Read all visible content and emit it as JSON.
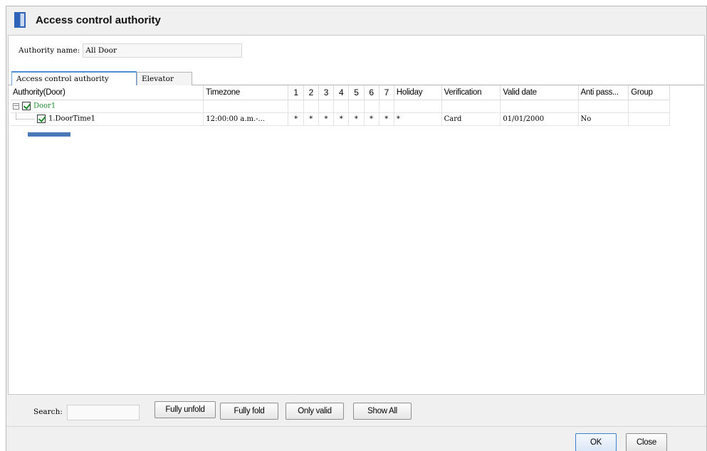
{
  "window": {
    "title": "Access control authority"
  },
  "authority": {
    "label": "Authority name:",
    "value": "All Door"
  },
  "tabs": [
    {
      "label": "Access control authority",
      "active": true
    },
    {
      "label": "Elevator",
      "active": false
    }
  ],
  "grid": {
    "columns": [
      "Authority(Door)",
      "Timezone",
      "1",
      "2",
      "3",
      "4",
      "5",
      "6",
      "7",
      "Holiday",
      "Verification",
      "Valid date",
      "Anti pass...",
      "Group"
    ],
    "door": {
      "name": "Door1",
      "checked": true,
      "expanded": true
    },
    "rows": [
      {
        "name": "1.DoorTime1",
        "checked": true,
        "timezone": "12:00:00 a.m.-...",
        "days": [
          "*",
          "*",
          "*",
          "*",
          "*",
          "*",
          "*"
        ],
        "holiday": "*",
        "verification": "Card",
        "valid_date": "01/01/2000",
        "anti_pass": "No",
        "group": ""
      }
    ]
  },
  "search": {
    "label": "Search:",
    "value": ""
  },
  "buttons": {
    "fully_unfold": "Fully unfold",
    "fully_fold": "Fully fold",
    "only_valid": "Only valid",
    "show_all": "Show All",
    "ok": "OK",
    "close": "Close"
  },
  "colors": {
    "accent": "#4f8fd6",
    "checked_green": "#1c8a2a",
    "selection": "#4a78b8"
  }
}
